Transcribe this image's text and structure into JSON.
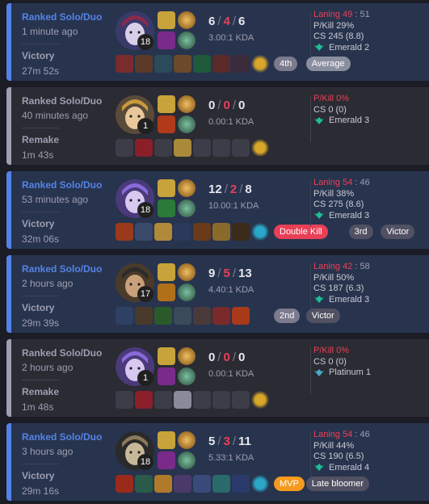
{
  "matches": [
    {
      "outcome": "win",
      "queue": "Ranked Solo/Duo",
      "time_ago": "1 minute ago",
      "result": "Victory",
      "duration": "27m 52s",
      "champion_icon": "champion-portrait-dark-purple",
      "level": "18",
      "kills": "6",
      "deaths": "4",
      "assists": "6",
      "kda_ratio": "3.00:1 KDA",
      "laning_label": "Laning 49",
      "laning_rest": " : 51",
      "pkill": "P/Kill 29%",
      "cs": "CS 245 (8.8)",
      "rank": "Emerald 2",
      "rank_icon": "emerald-wings-icon",
      "badges": [
        {
          "text": "4th",
          "style": "grey"
        },
        {
          "text": "Average",
          "style": "grey2"
        }
      ],
      "items": [
        "#7a2b2b",
        "#5b3a2a",
        "#2b4a5a",
        "#6a4a2a",
        "#1f5a3a",
        "#5a2a2a",
        "#3a2a3a"
      ],
      "ward": "#d8a628"
    },
    {
      "outcome": "remake",
      "queue": "Ranked Solo/Duo",
      "time_ago": "40 minutes ago",
      "result": "Remake",
      "duration": "1m 43s",
      "champion_icon": "champion-portrait-gold-mage",
      "level": "1",
      "kills": "0",
      "deaths": "0",
      "assists": "0",
      "kda_ratio": "0.00:1 KDA",
      "laning_label": "",
      "laning_rest": "",
      "pkill": "P/Kill 0%",
      "cs": "CS 0 (0)",
      "rank": "Emerald 3",
      "rank_icon": "emerald-wings-icon",
      "badges": [],
      "items": [
        "",
        "#8a1f2a",
        "",
        "#a88a3a",
        "",
        "",
        ""
      ],
      "ward": "#d8a628"
    },
    {
      "outcome": "win",
      "queue": "Ranked Solo/Duo",
      "time_ago": "53 minutes ago",
      "result": "Victory",
      "duration": "32m 06s",
      "champion_icon": "champion-portrait-violet-hair",
      "level": "18",
      "kills": "12",
      "deaths": "2",
      "assists": "8",
      "kda_ratio": "10.00:1 KDA",
      "laning_label": "Laning 54",
      "laning_rest": " : 46",
      "pkill": "P/Kill 38%",
      "cs": "CS 275 (8.6)",
      "rank": "Emerald 3",
      "rank_icon": "emerald-wings-icon",
      "badges": [
        {
          "text": "Double Kill",
          "style": "red"
        },
        {
          "text": "3rd",
          "style": "dark"
        },
        {
          "text": "Victor",
          "style": "dark"
        }
      ],
      "items": [
        "#9a3a1a",
        "#3a4a6a",
        "#b08a3a",
        "#2a3a5a",
        "#6a3a1a",
        "#8a6a2a",
        "#3a2a1a"
      ],
      "ward": "#2aa8c8"
    },
    {
      "outcome": "win",
      "queue": "Ranked Solo/Duo",
      "time_ago": "2 hours ago",
      "result": "Victory",
      "duration": "29m 39s",
      "champion_icon": "champion-portrait-swordsman",
      "level": "17",
      "kills": "9",
      "deaths": "5",
      "assists": "13",
      "kda_ratio": "4.40:1 KDA",
      "laning_label": "Laning 42",
      "laning_rest": " : 58",
      "pkill": "P/Kill 50%",
      "cs": "CS 187 (6.3)",
      "rank": "Emerald 3",
      "rank_icon": "emerald-wings-icon",
      "badges": [
        {
          "text": "2nd",
          "style": "grey"
        },
        {
          "text": "Victor",
          "style": "dark"
        }
      ],
      "items": [
        "#2e4063",
        "#4a3a2a",
        "#2a5a2a",
        "#3a4a5a",
        "#4a3a3a",
        "#7a2a2a",
        "#a83a1a"
      ],
      "ward": ""
    },
    {
      "outcome": "remake",
      "queue": "Ranked Solo/Duo",
      "time_ago": "2 hours ago",
      "result": "Remake",
      "duration": "1m 48s",
      "champion_icon": "champion-portrait-violet-hair",
      "level": "1",
      "kills": "0",
      "deaths": "0",
      "assists": "0",
      "kda_ratio": "0.00:1 KDA",
      "laning_label": "",
      "laning_rest": "",
      "pkill": "P/Kill 0%",
      "cs": "CS 0 (0)",
      "rank": "Platinum 1",
      "rank_icon": "platinum-wings-icon",
      "badges": [],
      "items": [
        "",
        "#8a1f2a",
        "",
        "#8a8a9a",
        "",
        "",
        ""
      ],
      "ward": "#d8a628"
    },
    {
      "outcome": "win",
      "queue": "Ranked Solo/Duo",
      "time_ago": "3 hours ago",
      "result": "Victory",
      "duration": "29m 16s",
      "champion_icon": "champion-portrait-helmet",
      "level": "18",
      "kills": "5",
      "deaths": "3",
      "assists": "11",
      "kda_ratio": "5.33:1 KDA",
      "laning_label": "Laning 54",
      "laning_rest": " : 46",
      "pkill": "P/Kill 44%",
      "cs": "CS 190 (6.5)",
      "rank": "Emerald 4",
      "rank_icon": "emerald-wings-icon",
      "badges": [
        {
          "text": "MVP",
          "style": "orange"
        },
        {
          "text": "Late bloomer",
          "style": "dark"
        }
      ],
      "items": [
        "#9a2a1a",
        "#2a5a4a",
        "#b07a2a",
        "#4a3a6a",
        "#3a4a7a",
        "#2a6a6a",
        "#2a3a6a"
      ],
      "ward": "#2aa8c8"
    }
  ],
  "colors": {
    "win_accent": "#5383e8",
    "remake_accent": "#9e9eb1",
    "death": "#e84057",
    "rank_green": "#1fbf8f",
    "rank_teal": "#4aa8c8"
  }
}
